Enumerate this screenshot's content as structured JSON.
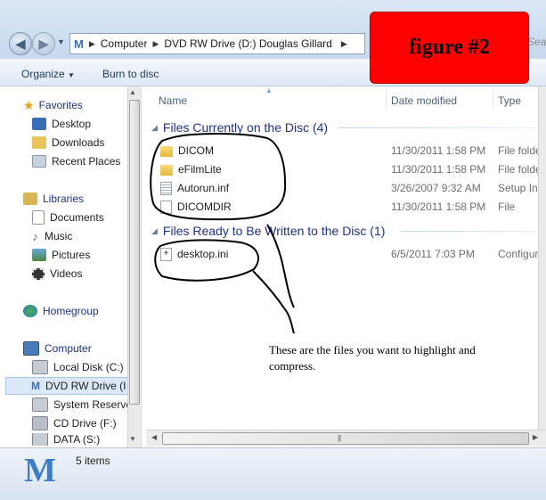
{
  "address_bar": {
    "segments": [
      "Computer",
      "DVD RW Drive (D:) Douglas Gillard"
    ]
  },
  "search": {
    "placeholder": "Searc"
  },
  "toolbar": {
    "organize_label": "Organize",
    "burn_label": "Burn to disc"
  },
  "sidebar": {
    "favorites": {
      "label": "Favorites",
      "items": [
        "Desktop",
        "Downloads",
        "Recent Places"
      ]
    },
    "libraries": {
      "label": "Libraries",
      "items": [
        "Documents",
        "Music",
        "Pictures",
        "Videos"
      ]
    },
    "homegroup": {
      "label": "Homegroup"
    },
    "computer": {
      "label": "Computer",
      "items": [
        "Local Disk (C:)",
        "DVD RW Drive (I",
        "System Reserved",
        "CD Drive (F:)",
        "DATA  (S:)"
      ]
    }
  },
  "columns": {
    "name": "Name",
    "date": "Date modified",
    "type": "Type"
  },
  "groups": [
    {
      "header": "Files Currently on the Disc (4)",
      "files": [
        {
          "name": "DICOM",
          "date": "11/30/2011 1:58 PM",
          "type": "File folder",
          "icon": "folder-icon"
        },
        {
          "name": "eFilmLite",
          "date": "11/30/2011 1:58 PM",
          "type": "File folder",
          "icon": "folder-icon"
        },
        {
          "name": "Autorun.inf",
          "date": "3/26/2007 9:32 AM",
          "type": "Setup Informa",
          "icon": "settings-file-icon"
        },
        {
          "name": "DICOMDIR",
          "date": "11/30/2011 1:58 PM",
          "type": "File",
          "icon": "file-icon"
        }
      ]
    },
    {
      "header": "Files Ready to Be Written to the Disc (1)",
      "files": [
        {
          "name": "desktop.ini",
          "date": "6/5/2011 7:03 PM",
          "type": "Configuratio",
          "icon": "pending-file-icon"
        }
      ]
    }
  ],
  "status": {
    "count_text": "5 items"
  },
  "annotation": {
    "figure_label": "figure #2",
    "note": "These are the files you want to highlight and compress."
  },
  "colors": {
    "annotation_box": "#ff0000",
    "group_header": "#1e3287"
  }
}
